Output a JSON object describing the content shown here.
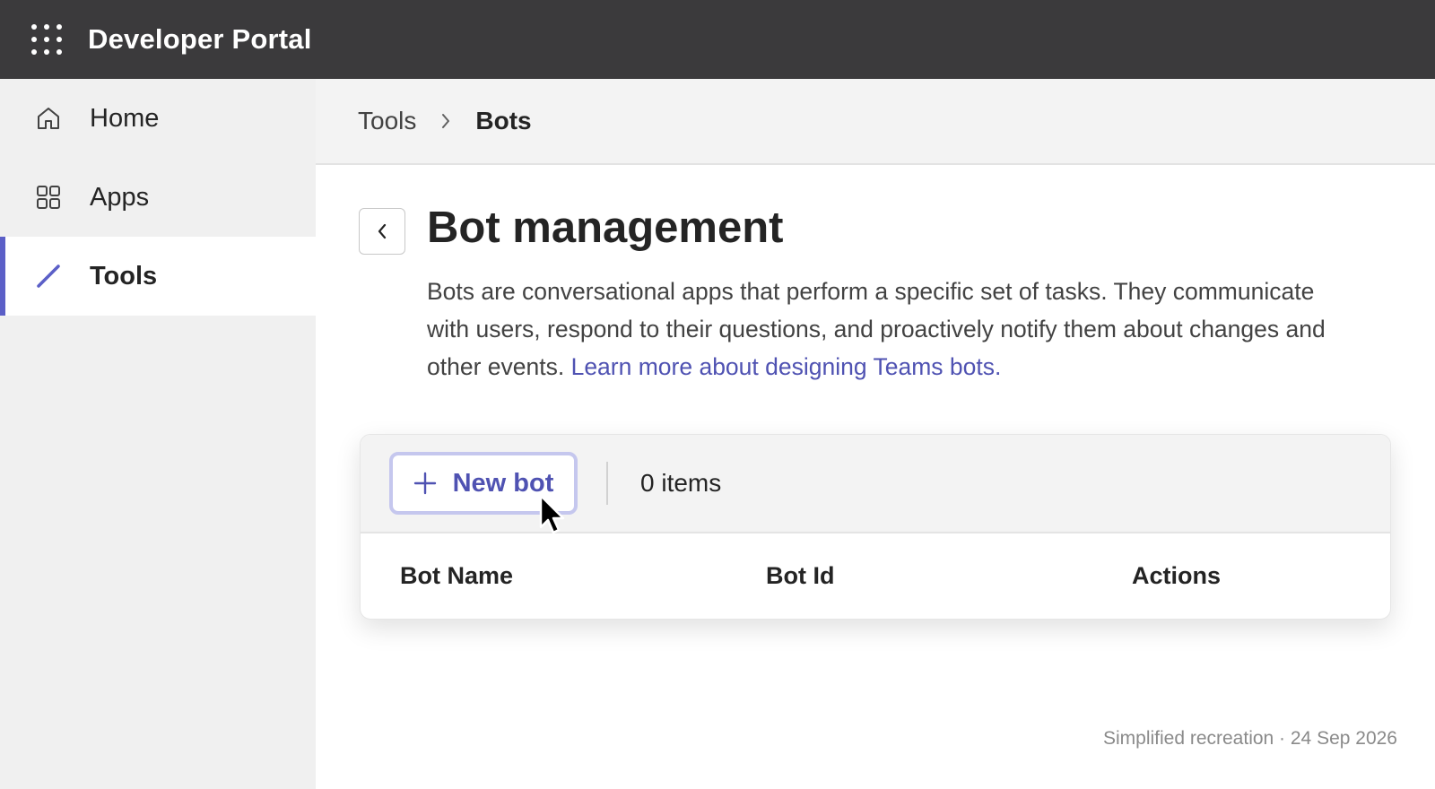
{
  "header": {
    "app_title": "Developer Portal",
    "waffle_icon": "app-launcher-icon"
  },
  "sidebar": {
    "items": [
      {
        "label": "Home",
        "icon": "home-icon",
        "active": false
      },
      {
        "label": "Apps",
        "icon": "apps-grid-icon",
        "active": false
      },
      {
        "label": "Tools",
        "icon": "pencil-icon",
        "active": true
      }
    ]
  },
  "breadcrumb": {
    "parent": "Tools",
    "current": "Bots"
  },
  "main": {
    "title": "Bot management",
    "description": "Bots are conversational apps that perform a specific set of tasks. They communicate with users, respond to their questions, and proactively notify them about changes and other events.",
    "learn_more_link": "Learn more about designing Teams bots."
  },
  "table": {
    "new_button_label": "New bot",
    "item_count": "0 items",
    "columns": [
      "Bot Name",
      "Bot Id",
      "Actions"
    ]
  },
  "footer": {
    "note": "Simplified recreation · 24 Sep 2026"
  },
  "colors": {
    "accent": "#5b5fc7",
    "link": "#4f52b2",
    "topbar": "#3b3a3c",
    "sidebar": "#f0f0f0"
  }
}
